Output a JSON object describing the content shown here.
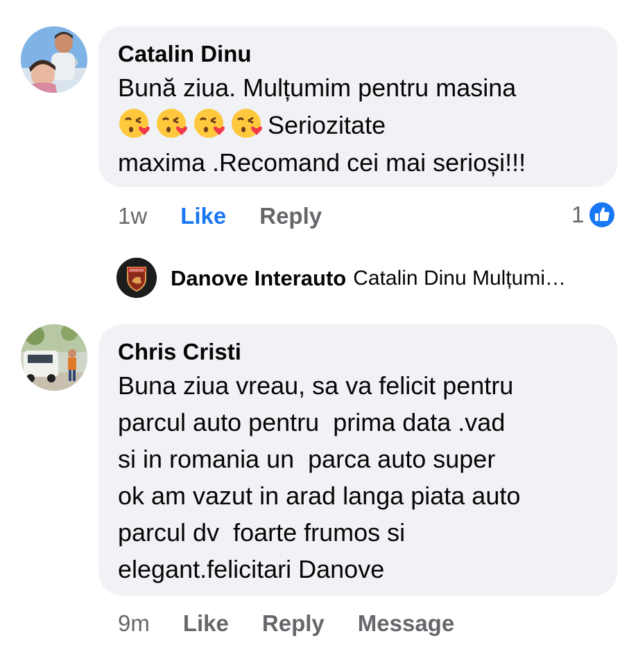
{
  "comments": [
    {
      "author": "Catalin Dinu",
      "text_line1": "Bună ziua. Mulțumim pentru masina",
      "emoji_name": "face-blowing-a-kiss",
      "emoji_count": 4,
      "text_line2_tail": "Seriozitate",
      "text_line3": "maxima .Recomand cei mai serioși!!!",
      "time": "1w",
      "like_label": "Like",
      "reply_label": "Reply",
      "reaction_count": "1",
      "reaction_icon": "like-thumb-icon"
    },
    {
      "author": "Chris Cristi",
      "text": "Buna ziua vreau, sa va felicit pentru\nparcul auto pentru  prima data .vad\nsi in romania un  parca auto super\nok am vazut in arad langa piata auto\nparcul dv  foarte frumos si\nelegant.felicitari Danove",
      "time": "9m",
      "like_label": "Like",
      "reply_label": "Reply",
      "message_label": "Message"
    }
  ],
  "reply": {
    "author": "Danove Interauto",
    "preview": "Catalin Dinu Mulțumi…",
    "avatar_text": "DANOVE"
  },
  "colors": {
    "bubble": "#f0f2f5",
    "like_active": "#1877f2",
    "meta": "#65676b",
    "text": "#050505"
  }
}
